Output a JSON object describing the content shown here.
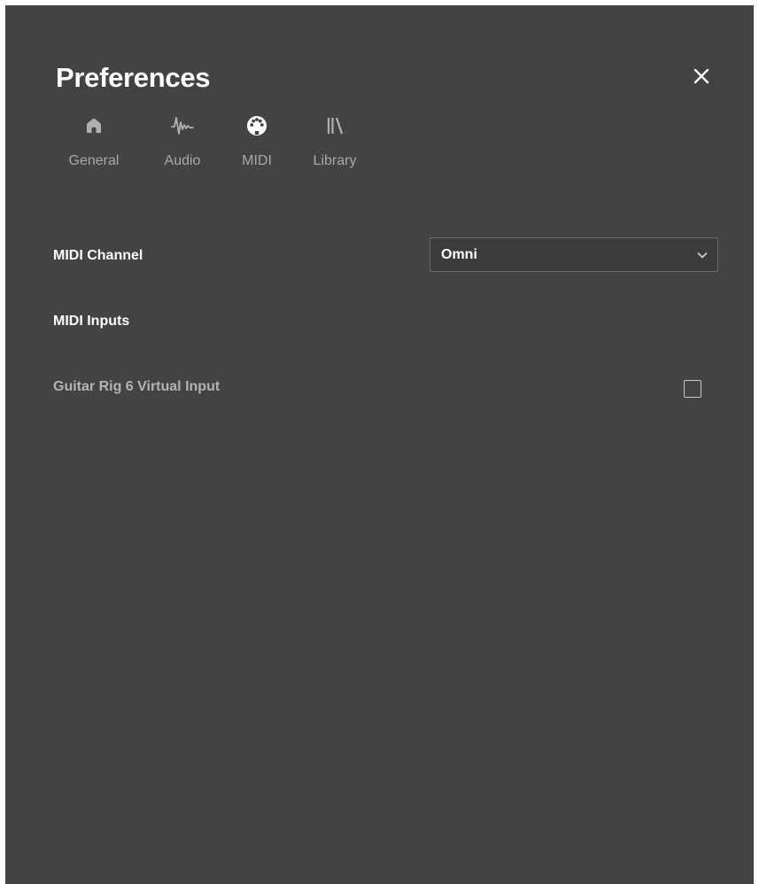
{
  "dialog": {
    "title": "Preferences",
    "close_icon": "close-icon"
  },
  "tabs": [
    {
      "label": "General",
      "icon": "home-icon",
      "active": false
    },
    {
      "label": "Audio",
      "icon": "waveform-icon",
      "active": false
    },
    {
      "label": "MIDI",
      "icon": "midi-connector-icon",
      "active": true
    },
    {
      "label": "Library",
      "icon": "library-icon",
      "active": false
    }
  ],
  "midi": {
    "channel_label": "MIDI Channel",
    "channel_value": "Omni",
    "inputs_heading": "MIDI Inputs",
    "inputs": [
      {
        "name": "Guitar Rig 6 Virtual Input",
        "checked": false
      }
    ]
  },
  "colors": {
    "background": "#434343",
    "text_primary": "#ffffff",
    "text_muted": "#a9a9a9"
  }
}
